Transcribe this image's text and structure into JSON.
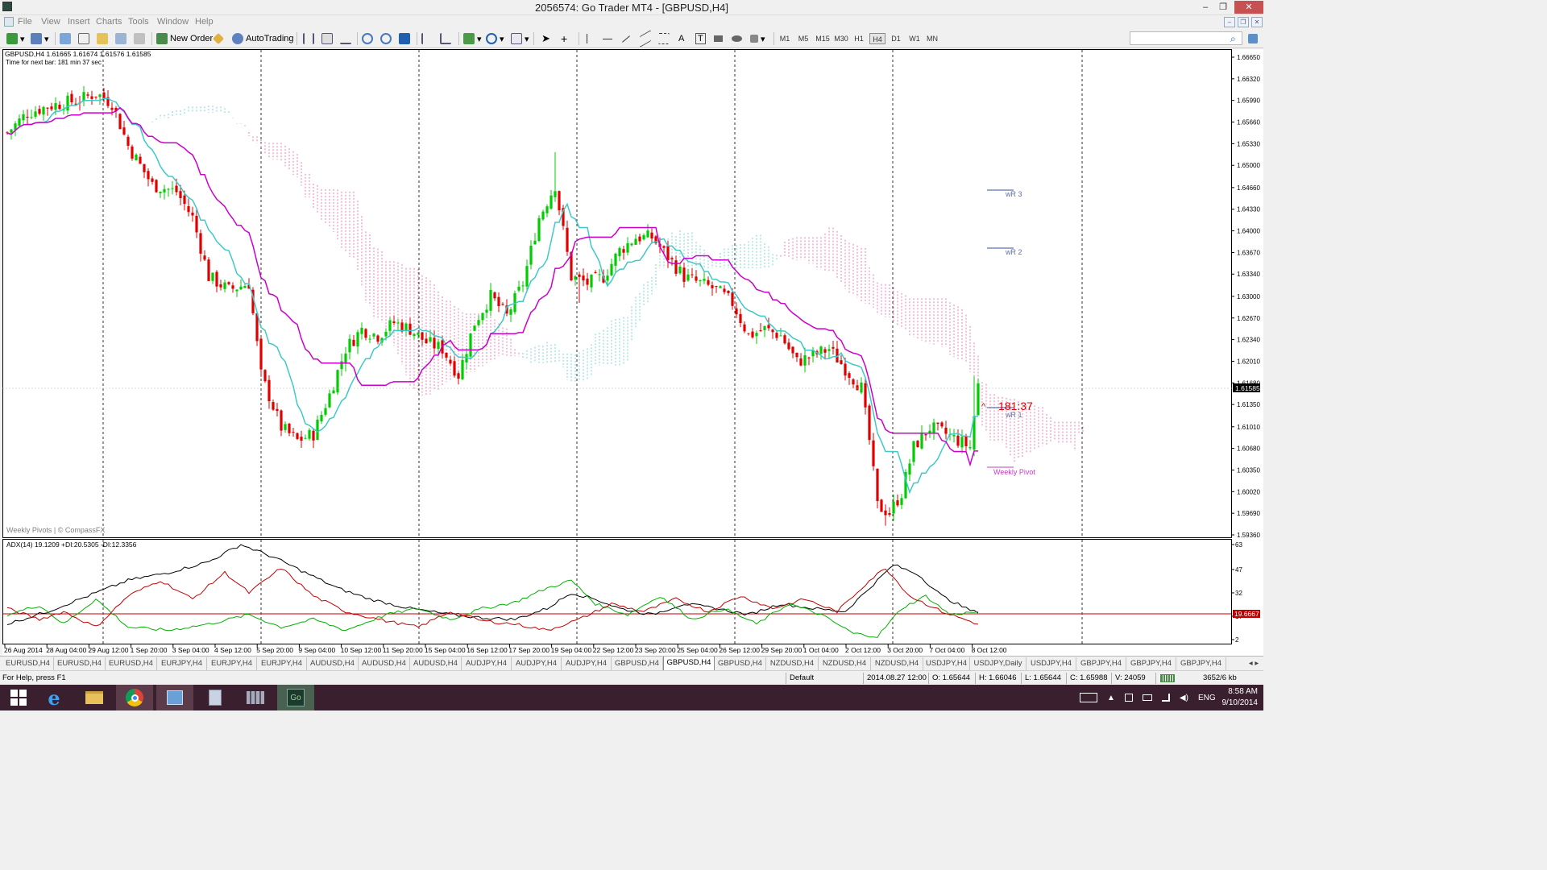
{
  "window": {
    "title": "2056574: Go Trader MT4 - [GBPUSD,H4]",
    "controls": [
      "–",
      "❐",
      "✕"
    ],
    "mdi_controls": [
      "–",
      "❐",
      "✕"
    ]
  },
  "menu": [
    "File",
    "View",
    "Insert",
    "Charts",
    "Tools",
    "Window",
    "Help"
  ],
  "toolbar": {
    "new_order": "New Order",
    "autotrading": "AutoTrading",
    "timeframes": [
      "M1",
      "M5",
      "M15",
      "M30",
      "H1",
      "H4",
      "D1",
      "W1",
      "MN"
    ],
    "active_timeframe": "H4",
    "drawing_tools": [
      "cursor",
      "crosshair",
      "vertical-line",
      "horizontal-line",
      "trendline",
      "channel",
      "fibonacci",
      "A",
      "T",
      "rectangle",
      "ellipse",
      "arrow"
    ]
  },
  "chart": {
    "info_line": "GBPUSD,H4  1.61665 1.61674 1.61576 1.61585",
    "timer_line": "Time for next bar: 181 min 37 sec",
    "watermark": "Weekly Pivots | © CompassFX",
    "current_price": "1.61585",
    "countdown": "181:37",
    "price_axis": [
      "1.66650",
      "1.66320",
      "1.65990",
      "1.65660",
      "1.65330",
      "1.65000",
      "1.64660",
      "1.64330",
      "1.64000",
      "1.63670",
      "1.63340",
      "1.63000",
      "1.62670",
      "1.62340",
      "1.62010",
      "1.61680",
      "1.61350",
      "1.61010",
      "1.60680",
      "1.60350",
      "1.60020",
      "1.59690",
      "1.59360"
    ],
    "pivot_labels": {
      "wr3": "wR 3",
      "wr2": "wR 2",
      "wr1": "wR 1",
      "pivot": "Weekly Pivot"
    },
    "indicator_label": "ADX(14) 19.1209 +DI:20.5305 -DI:12.3356",
    "indicator_axis": [
      "63",
      "47",
      "32",
      "17",
      "2"
    ],
    "indicator_level": "19.6667",
    "time_axis": [
      "26 Aug 2014",
      "28 Aug 04:00",
      "29 Aug 12:00",
      "1 Sep 20:00",
      "3 Sep 04:00",
      "4 Sep 12:00",
      "5 Sep 20:00",
      "9 Sep 04:00",
      "10 Sep 12:00",
      "11 Sep 20:00",
      "15 Sep 04:00",
      "16 Sep 12:00",
      "17 Sep 20:00",
      "19 Sep 04:00",
      "22 Sep 12:00",
      "23 Sep 20:00",
      "25 Sep 04:00",
      "26 Sep 12:00",
      "29 Sep 20:00",
      "1 Oct 04:00",
      "2 Oct 12:00",
      "3 Oct 20:00",
      "7 Oct 04:00",
      "8 Oct 12:00"
    ],
    "colors": {
      "bull": "#00cc00",
      "bear": "#e00000",
      "tenkan": "#40c8c8",
      "kijun": "#cc00cc",
      "cloud_red": "#e060a0",
      "cloud_green": "#60c8c8",
      "adx": "#000000",
      "plus_di": "#00b000",
      "minus_di": "#c00000",
      "level": "#c00000"
    }
  },
  "tabs": [
    "EURUSD,H4",
    "EURUSD,H4",
    "EURUSD,H4",
    "EURJPY,H4",
    "EURJPY,H4",
    "EURJPY,H4",
    "AUDUSD,H4",
    "AUDUSD,H4",
    "AUDUSD,H4",
    "AUDJPY,H4",
    "AUDJPY,H4",
    "AUDJPY,H4",
    "GBPUSD,H4",
    "GBPUSD,H4",
    "GBPUSD,H4",
    "NZDUSD,H4",
    "NZDUSD,H4",
    "NZDUSD,H4",
    "USDJPY,H4",
    "USDJPY,Daily",
    "USDJPY,H4",
    "GBPJPY,H4",
    "GBPJPY,H4",
    "GBPJPY,H4"
  ],
  "active_tab_index": 13,
  "status": {
    "help": "For Help, press F1",
    "profile": "Default",
    "datetime": "2014.08.27 12:00",
    "open": "O: 1.65644",
    "high": "H: 1.66046",
    "low": "L: 1.65644",
    "close": "C: 1.65988",
    "volume": "V: 24059",
    "traffic": "3652/6 kb"
  },
  "taskbar": {
    "apps": [
      "windows-start",
      "internet-explorer",
      "file-explorer",
      "chrome",
      "control-panel",
      "calculator",
      "task-view",
      "go-trader-mt4"
    ],
    "language": "ENG",
    "time": "8:58 AM",
    "date": "9/10/2014"
  }
}
